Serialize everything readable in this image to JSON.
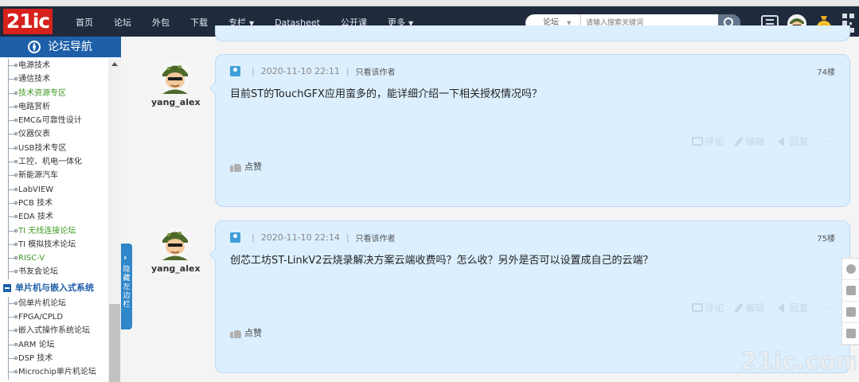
{
  "logo": "21ic",
  "nav": {
    "items": [
      {
        "label": "首页",
        "dropdown": false
      },
      {
        "label": "论坛",
        "dropdown": false
      },
      {
        "label": "外包",
        "dropdown": false
      },
      {
        "label": "下载",
        "dropdown": false
      },
      {
        "label": "专栏",
        "dropdown": true
      },
      {
        "label": "Datasheet",
        "dropdown": false
      },
      {
        "label": "公开课",
        "dropdown": false
      },
      {
        "label": "更多",
        "dropdown": true
      }
    ]
  },
  "search": {
    "category": "论坛",
    "placeholder": "请输入搜索关键词"
  },
  "top_icons": [
    "list-icon",
    "user-avatar",
    "money-bag-icon",
    "qr-code-icon"
  ],
  "sidebar": {
    "title": "论坛导航",
    "items": [
      {
        "label": "电源技术",
        "highlight": false
      },
      {
        "label": "通信技术",
        "highlight": false
      },
      {
        "label": "技术资源专区",
        "highlight": true
      },
      {
        "label": "电路赏析",
        "highlight": false
      },
      {
        "label": "EMC&可靠性设计",
        "highlight": false
      },
      {
        "label": "仪器仪表",
        "highlight": false
      },
      {
        "label": "USB技术专区",
        "highlight": false
      },
      {
        "label": "工控、机电一体化",
        "highlight": false
      },
      {
        "label": "新能源汽车",
        "highlight": false
      },
      {
        "label": "LabVIEW",
        "highlight": false
      },
      {
        "label": "PCB 技术",
        "highlight": false
      },
      {
        "label": "EDA 技术",
        "highlight": false
      },
      {
        "label": "TI 无线连接论坛",
        "highlight": true
      },
      {
        "label": "TI 模拟技术论坛",
        "highlight": false
      },
      {
        "label": "RISC-V",
        "highlight": true
      },
      {
        "label": "书友会论坛",
        "highlight": false
      }
    ],
    "group": "单片机与嵌入式系统",
    "group_items": [
      {
        "label": "侃单片机论坛",
        "highlight": false
      },
      {
        "label": "FPGA/CPLD",
        "highlight": false
      },
      {
        "label": "嵌入式操作系统论坛",
        "highlight": false
      },
      {
        "label": "ARM 论坛",
        "highlight": false
      },
      {
        "label": "DSP 技术",
        "highlight": false
      },
      {
        "label": "Microchip单片机论坛",
        "highlight": false
      }
    ],
    "hide_tab": "隐藏左边栏"
  },
  "posts": [
    {
      "username": "yang_alex",
      "datetime": "2020-11-10 22:11",
      "author_only": "只看该作者",
      "floor": "74楼",
      "content": "目前ST的TouchGFX应用蛮多的，能详细介绍一下相关授权情况吗？",
      "actions": {
        "comment": "评论",
        "edit": "编辑",
        "reply": "回复",
        "more": "···"
      },
      "like": "点赞"
    },
    {
      "username": "yang_alex",
      "datetime": "2020-11-10 22:14",
      "author_only": "只看该作者",
      "floor": "75楼",
      "content": "创芯工坊ST-LinkV2云烧录解决方案云端收费吗？怎么收？另外是否可以设置成自己的云端？",
      "actions": {
        "comment": "评论",
        "edit": "编辑",
        "reply": "回复",
        "more": "···"
      },
      "like": "点赞"
    }
  ],
  "watermark": "21ic.com"
}
